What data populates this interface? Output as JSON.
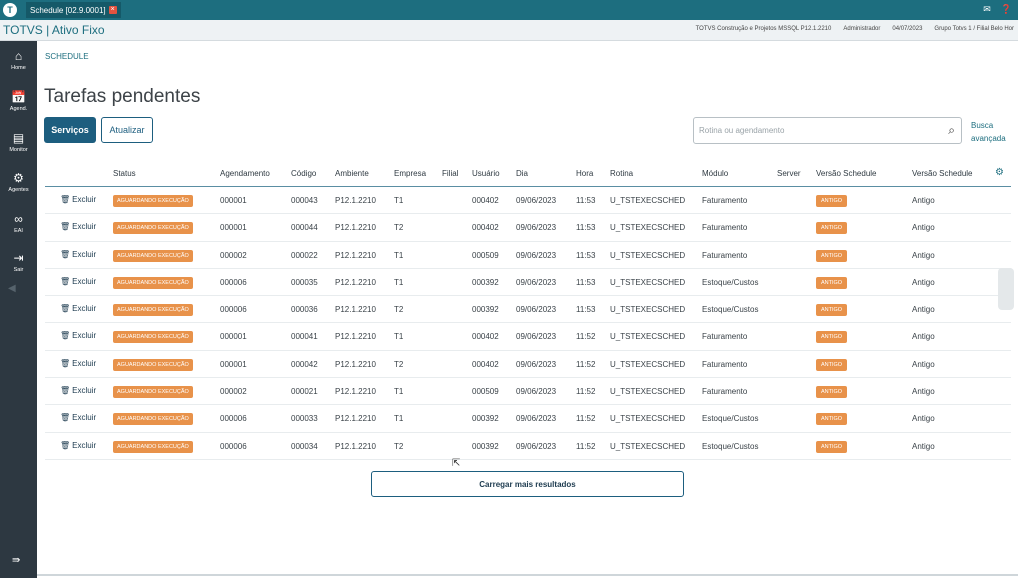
{
  "window": {
    "tab_title": "Schedule [02.9.0001]",
    "tab_close": "×",
    "logo": "T",
    "icons": [
      "mail-icon",
      "help-icon"
    ]
  },
  "app": {
    "title": "TOTVS | Ativo Fixo",
    "info": {
      "product": "TOTVS Construção e Projetos MSSQL P12.1.2210",
      "user": "Administrador",
      "date": "04/07/2023",
      "branch": "Grupo Totvs 1 / Filial Belo Hor"
    }
  },
  "sidebar": {
    "items": [
      {
        "label": "Home",
        "icon": "home-icon"
      },
      {
        "label": "Agend.",
        "icon": "calendar-icon"
      },
      {
        "label": "Monitor",
        "icon": "monitor-icon"
      },
      {
        "label": "Agentes",
        "icon": "agents-icon"
      },
      {
        "label": "EAI",
        "icon": "eai-icon"
      },
      {
        "label": "Sair",
        "icon": "exit-icon"
      }
    ]
  },
  "breadcrumb": "SCHEDULE",
  "page_title": "Tarefas pendentes",
  "buttons": {
    "services": "Serviços",
    "refresh": "Atualizar",
    "load_more": "Carregar mais resultados"
  },
  "search": {
    "placeholder": "Rotina ou agendamento",
    "value": "",
    "advanced_line1": "Busca",
    "advanced_line2": "avançada"
  },
  "table": {
    "columns": [
      "Status",
      "Agendamento",
      "Código",
      "Ambiente",
      "Empresa",
      "Filial",
      "Usuário",
      "Dia",
      "Hora",
      "Rotina",
      "Módulo",
      "Server",
      "Versão Schedule",
      "Versão Schedule"
    ],
    "delete_label": "Excluir",
    "rows": [
      {
        "status": "AGUARDANDO EXECUÇÃO",
        "agendamento": "000001",
        "codigo": "000043",
        "ambiente": "P12.1.2210",
        "empresa": "T1",
        "filial": "",
        "usuario": "000402",
        "dia": "09/06/2023",
        "hora": "11:53",
        "rotina": "U_TSTEXECSCHED",
        "modulo": "Faturamento",
        "server": "",
        "versao_badge": "ANTIGO",
        "versao": "Antigo"
      },
      {
        "status": "AGUARDANDO EXECUÇÃO",
        "agendamento": "000001",
        "codigo": "000044",
        "ambiente": "P12.1.2210",
        "empresa": "T2",
        "filial": "",
        "usuario": "000402",
        "dia": "09/06/2023",
        "hora": "11:53",
        "rotina": "U_TSTEXECSCHED",
        "modulo": "Faturamento",
        "server": "",
        "versao_badge": "ANTIGO",
        "versao": "Antigo"
      },
      {
        "status": "AGUARDANDO EXECUÇÃO",
        "agendamento": "000002",
        "codigo": "000022",
        "ambiente": "P12.1.2210",
        "empresa": "T1",
        "filial": "",
        "usuario": "000509",
        "dia": "09/06/2023",
        "hora": "11:53",
        "rotina": "U_TSTEXECSCHED",
        "modulo": "Faturamento",
        "server": "",
        "versao_badge": "ANTIGO",
        "versao": "Antigo"
      },
      {
        "status": "AGUARDANDO EXECUÇÃO",
        "agendamento": "000006",
        "codigo": "000035",
        "ambiente": "P12.1.2210",
        "empresa": "T1",
        "filial": "",
        "usuario": "000392",
        "dia": "09/06/2023",
        "hora": "11:53",
        "rotina": "U_TSTEXECSCHED",
        "modulo": "Estoque/Custos",
        "server": "",
        "versao_badge": "ANTIGO",
        "versao": "Antigo"
      },
      {
        "status": "AGUARDANDO EXECUÇÃO",
        "agendamento": "000006",
        "codigo": "000036",
        "ambiente": "P12.1.2210",
        "empresa": "T2",
        "filial": "",
        "usuario": "000392",
        "dia": "09/06/2023",
        "hora": "11:53",
        "rotina": "U_TSTEXECSCHED",
        "modulo": "Estoque/Custos",
        "server": "",
        "versao_badge": "ANTIGO",
        "versao": "Antigo"
      },
      {
        "status": "AGUARDANDO EXECUÇÃO",
        "agendamento": "000001",
        "codigo": "000041",
        "ambiente": "P12.1.2210",
        "empresa": "T1",
        "filial": "",
        "usuario": "000402",
        "dia": "09/06/2023",
        "hora": "11:52",
        "rotina": "U_TSTEXECSCHED",
        "modulo": "Faturamento",
        "server": "",
        "versao_badge": "ANTIGO",
        "versao": "Antigo"
      },
      {
        "status": "AGUARDANDO EXECUÇÃO",
        "agendamento": "000001",
        "codigo": "000042",
        "ambiente": "P12.1.2210",
        "empresa": "T2",
        "filial": "",
        "usuario": "000402",
        "dia": "09/06/2023",
        "hora": "11:52",
        "rotina": "U_TSTEXECSCHED",
        "modulo": "Faturamento",
        "server": "",
        "versao_badge": "ANTIGO",
        "versao": "Antigo"
      },
      {
        "status": "AGUARDANDO EXECUÇÃO",
        "agendamento": "000002",
        "codigo": "000021",
        "ambiente": "P12.1.2210",
        "empresa": "T1",
        "filial": "",
        "usuario": "000509",
        "dia": "09/06/2023",
        "hora": "11:52",
        "rotina": "U_TSTEXECSCHED",
        "modulo": "Faturamento",
        "server": "",
        "versao_badge": "ANTIGO",
        "versao": "Antigo"
      },
      {
        "status": "AGUARDANDO EXECUÇÃO",
        "agendamento": "000006",
        "codigo": "000033",
        "ambiente": "P12.1.2210",
        "empresa": "T1",
        "filial": "",
        "usuario": "000392",
        "dia": "09/06/2023",
        "hora": "11:52",
        "rotina": "U_TSTEXECSCHED",
        "modulo": "Estoque/Custos",
        "server": "",
        "versao_badge": "ANTIGO",
        "versao": "Antigo"
      },
      {
        "status": "AGUARDANDO EXECUÇÃO",
        "agendamento": "000006",
        "codigo": "000034",
        "ambiente": "P12.1.2210",
        "empresa": "T2",
        "filial": "",
        "usuario": "000392",
        "dia": "09/06/2023",
        "hora": "11:52",
        "rotina": "U_TSTEXECSCHED",
        "modulo": "Estoque/Custos",
        "server": "",
        "versao_badge": "ANTIGO",
        "versao": "Antigo"
      }
    ]
  },
  "colors": {
    "teal": "#1d6e7f",
    "sidebar": "#2d3841",
    "primary": "#1d5e7f",
    "badge": "#e8924a"
  }
}
